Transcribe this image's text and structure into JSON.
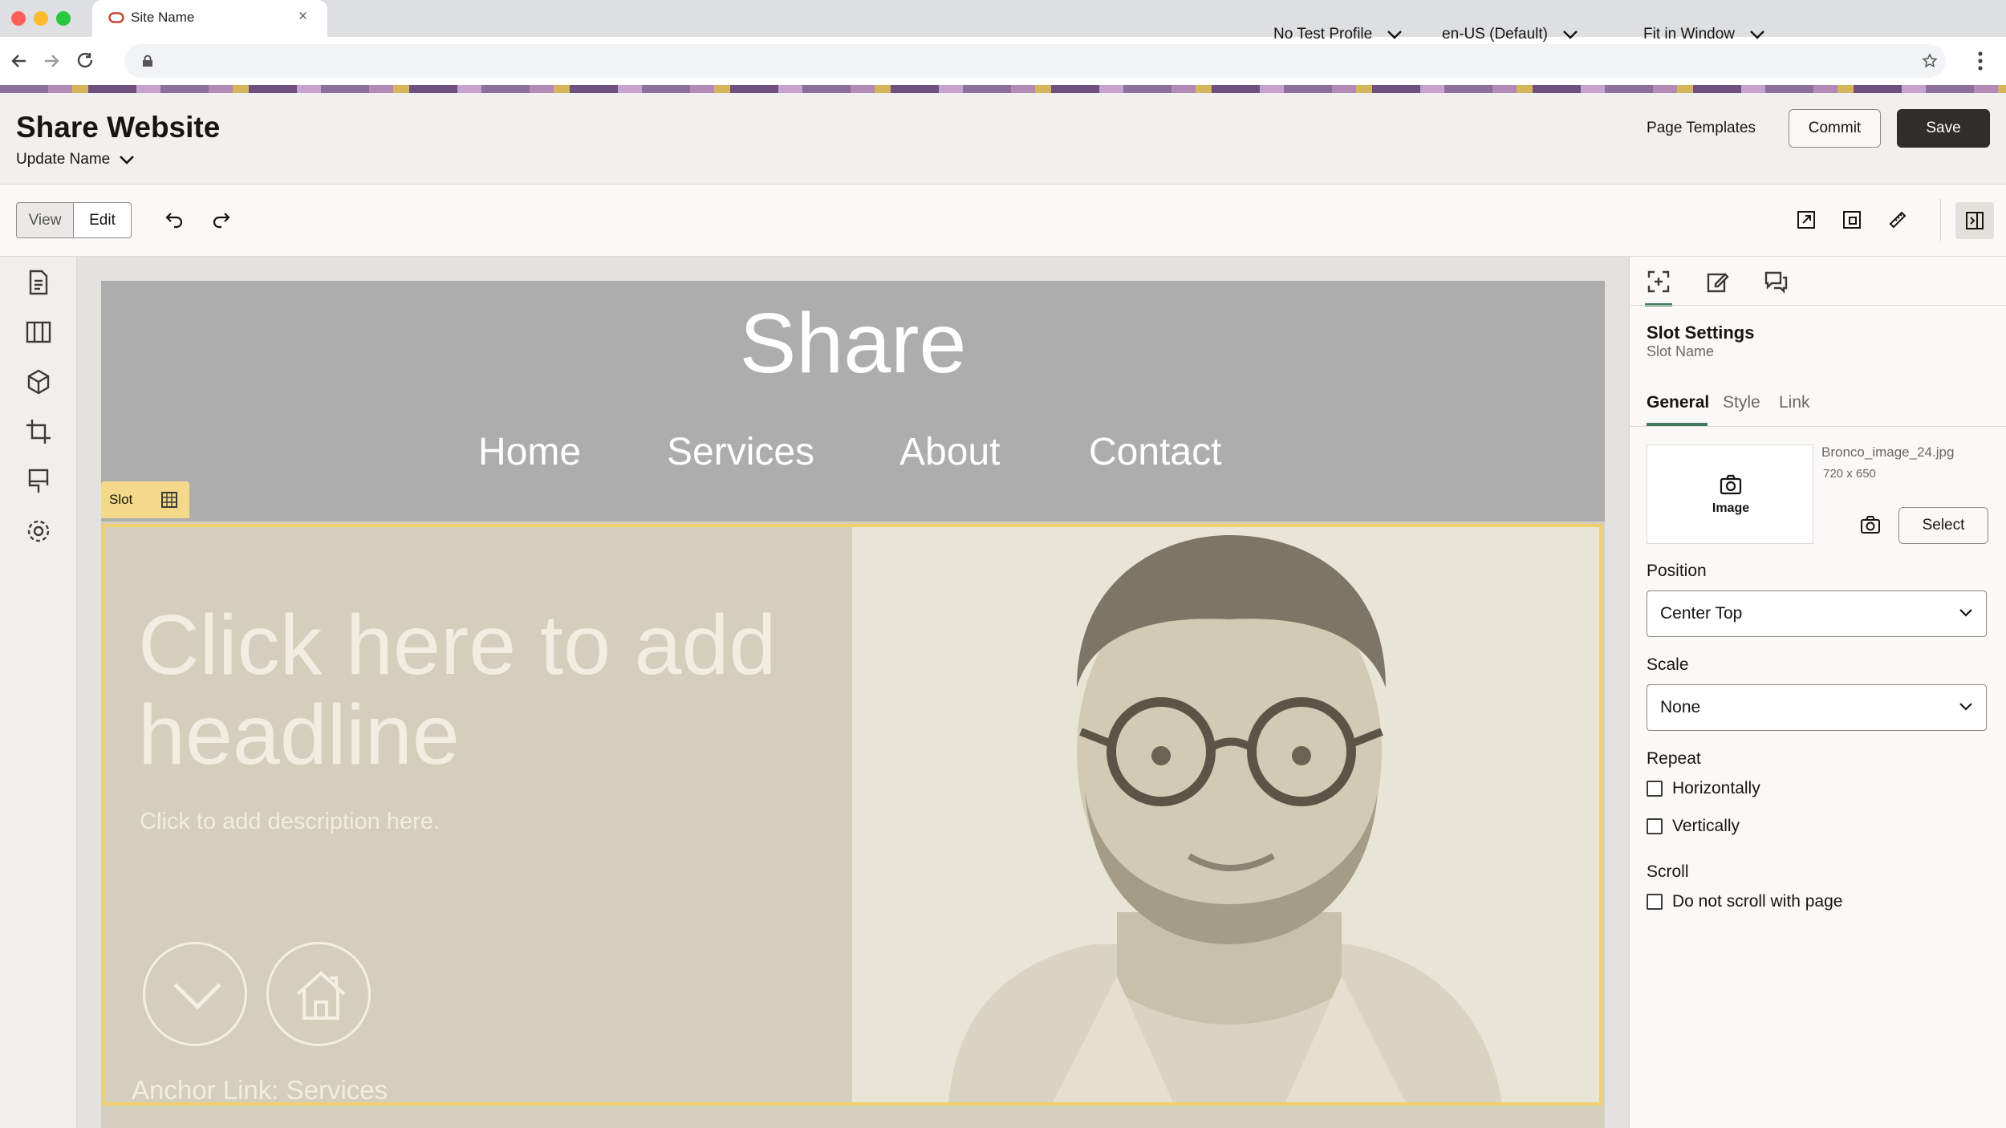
{
  "browser": {
    "tab_title": "Site Name",
    "tab_close": "×"
  },
  "header": {
    "title": "Share Website",
    "update_label": "Update Name",
    "page_templates": "Page Templates",
    "commit": "Commit",
    "save": "Save"
  },
  "toolbar": {
    "view": "View",
    "edit": "Edit",
    "test_profile": "No Test Profile",
    "locale": "en-US (Default)",
    "zoom": "Fit in Window"
  },
  "site": {
    "title": "Share",
    "nav": [
      "Home",
      "Services",
      "About",
      "Contact"
    ],
    "slot_label": "Slot",
    "headline": "Click here to add headline",
    "description": "Click to add description here.",
    "anchor_link": "Anchor Link: Services"
  },
  "panel": {
    "title": "Slot Settings",
    "subtitle": "Slot Name",
    "tabs": [
      "General",
      "Style",
      "Link"
    ],
    "active_tab": "General",
    "image_label": "Image",
    "image_filename": "Bronco_image_24.jpg",
    "image_size": "720 x 650",
    "select_button": "Select",
    "position_label": "Position",
    "position_value": "Center Top",
    "scale_label": "Scale",
    "scale_value": "None",
    "repeat_label": "Repeat",
    "repeat_horizontal": "Horizontally",
    "repeat_vertical": "Vertically",
    "scroll_label": "Scroll",
    "scroll_option": "Do not scroll with page"
  },
  "colors": {
    "accent_green": "#3d7a5c",
    "save_button": "#312d2a",
    "slot_highlight": "#f1cf6a"
  }
}
